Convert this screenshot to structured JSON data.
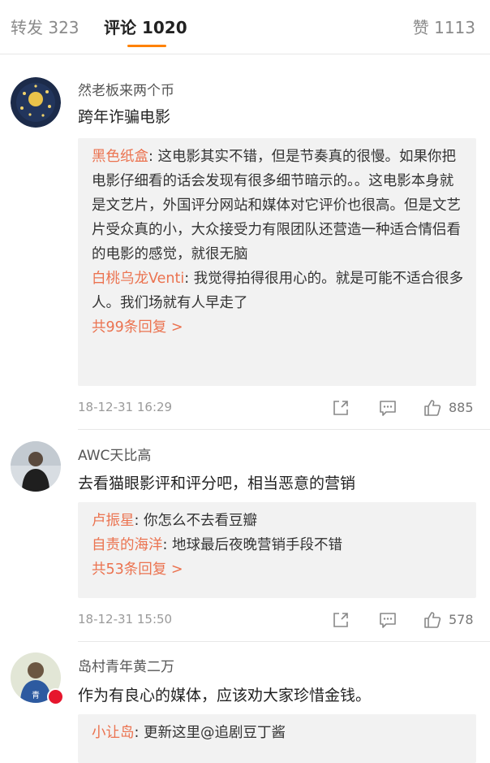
{
  "tabs": {
    "repost": "转发 323",
    "comments": "评论 1020",
    "likes": "赞 1113"
  },
  "colors": {
    "accent": "#ff8200",
    "reply_user": "#eb7350",
    "vip_badge": "#e6162d"
  },
  "comments": [
    {
      "user": "然老板来两个币",
      "text": "跨年诈骗电影",
      "replies": [
        {
          "user": "黑色纸盒",
          "text": ": 这电影其实不错，但是节奏真的很慢。如果你把电影仔细看的话会发现有很多细节暗示的。。这电影本身就是文艺片，外国评分网站和媒体对它评价也很高。但是文艺片受众真的小，大众接受力有限团队还营造一种适合情侣看的电影的感觉，就很无脑"
        },
        {
          "user": "白桃乌龙Venti",
          "text": ": 我觉得拍得很用心的。就是可能不适合很多人。我们场就有人早走了"
        }
      ],
      "more": "共99条回复 >",
      "time": "18-12-31 16:29",
      "likes": "885",
      "avatar_icon": "avatar-dark-circle-icon"
    },
    {
      "user": "AWC天比高",
      "text": "去看猫眼影评和评分吧，相当恶意的营销",
      "replies": [
        {
          "user": "卢振星",
          "text": ": 你怎么不去看豆瓣"
        },
        {
          "user": "自责的海洋",
          "text": ": 地球最后夜晚营销手段不错"
        }
      ],
      "more": "共53条回复 >",
      "time": "18-12-31 15:50",
      "likes": "578",
      "avatar_icon": "avatar-person-icon"
    },
    {
      "user": "岛村青年黄二万",
      "text": "作为有良心的媒体，应该劝大家珍惜金钱。",
      "replies": [
        {
          "user": "小让岛",
          "text": ": 更新这里@追剧豆丁酱"
        }
      ],
      "avatar_icon": "avatar-person-icon"
    }
  ]
}
